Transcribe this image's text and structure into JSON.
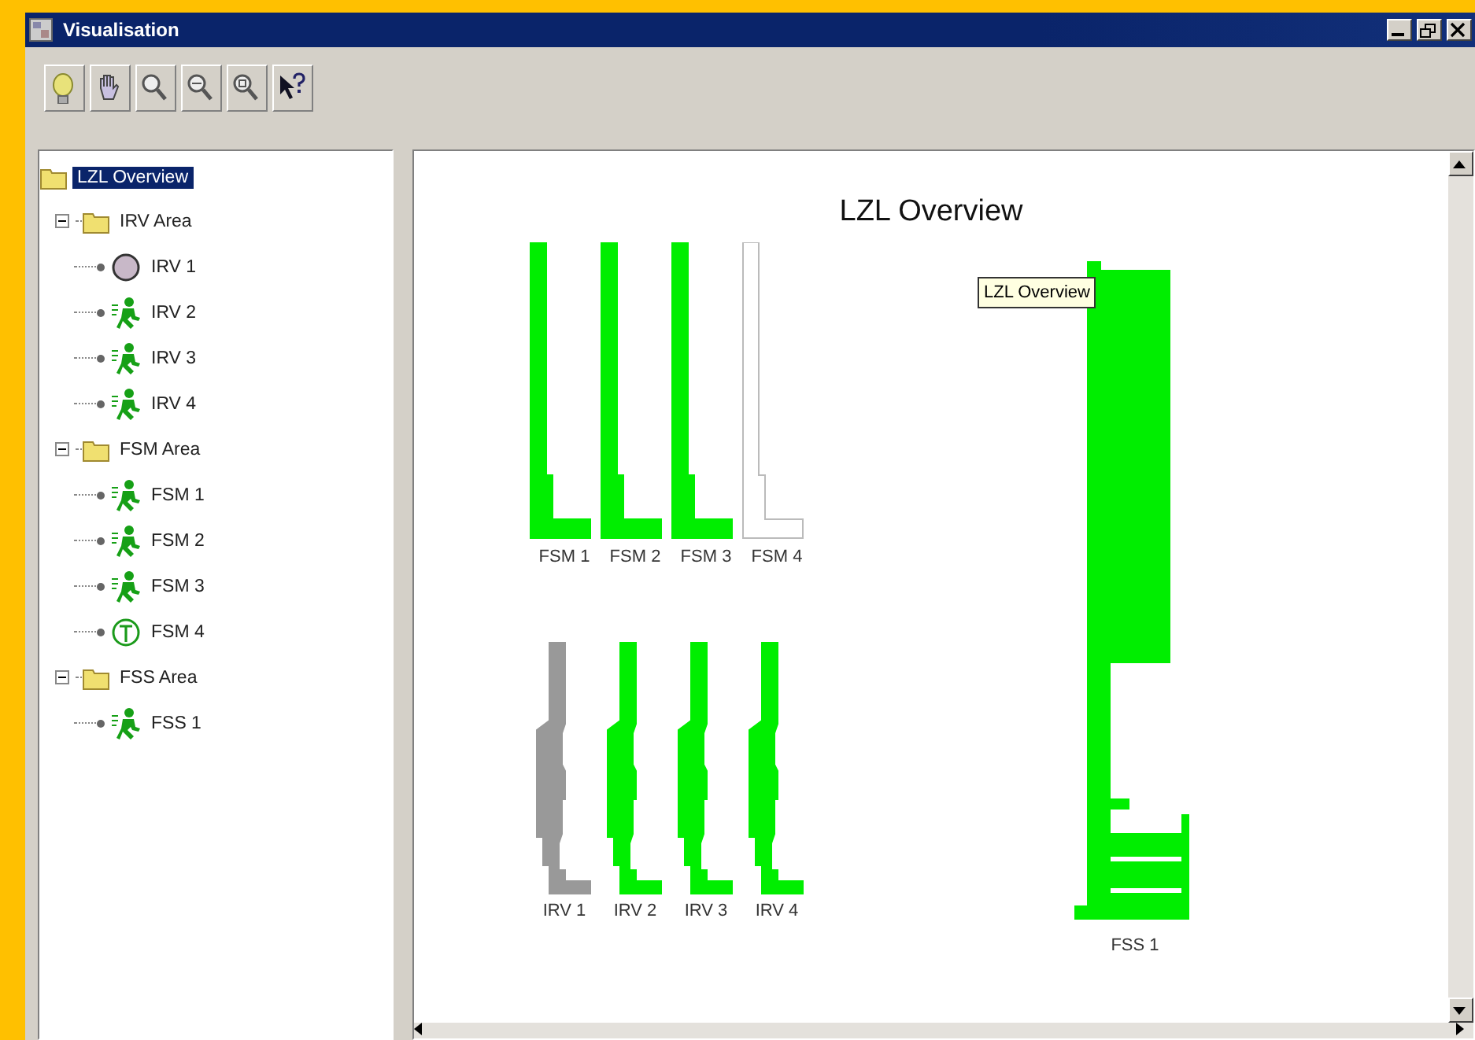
{
  "window": {
    "title": "Visualisation"
  },
  "tree": {
    "label": "LZL Overview",
    "selected": true,
    "children": [
      {
        "label": "IRV Area",
        "selected": false,
        "expanded": true,
        "children": [
          {
            "label": "IRV 1",
            "kind": "stopped",
            "selected": false
          },
          {
            "label": "IRV 2",
            "kind": "running",
            "selected": false
          },
          {
            "label": "IRV 3",
            "kind": "running",
            "selected": false
          },
          {
            "label": "IRV 4",
            "kind": "running",
            "selected": false
          }
        ]
      },
      {
        "label": "FSM Area",
        "selected": false,
        "expanded": true,
        "children": [
          {
            "label": "FSM 1",
            "kind": "running",
            "selected": false
          },
          {
            "label": "FSM 2",
            "kind": "running",
            "selected": false
          },
          {
            "label": "FSM 3",
            "kind": "running",
            "selected": false
          },
          {
            "label": "FSM 4",
            "kind": "maintenance",
            "selected": false
          }
        ]
      },
      {
        "label": "FSS Area",
        "selected": false,
        "expanded": true,
        "children": [
          {
            "label": "FSS 1",
            "kind": "running",
            "selected": false
          }
        ]
      }
    ]
  },
  "canvas": {
    "title": "LZL Overview",
    "tooltip": "LZL Overview",
    "groups": [
      {
        "kind": "fsm",
        "machines": [
          {
            "label": "FSM 1",
            "kind": "running"
          },
          {
            "label": "FSM 2",
            "kind": "running"
          },
          {
            "label": "FSM 3",
            "kind": "running"
          },
          {
            "label": "FSM 4",
            "kind": "maintenance"
          }
        ]
      },
      {
        "kind": "irv",
        "machines": [
          {
            "label": "IRV 1",
            "kind": "stopped"
          },
          {
            "label": "IRV 2",
            "kind": "running"
          },
          {
            "label": "IRV 3",
            "kind": "running"
          },
          {
            "label": "IRV 4",
            "kind": "running"
          }
        ]
      },
      {
        "kind": "fss",
        "machines": [
          {
            "label": "FSS 1",
            "kind": "running"
          }
        ]
      }
    ]
  }
}
